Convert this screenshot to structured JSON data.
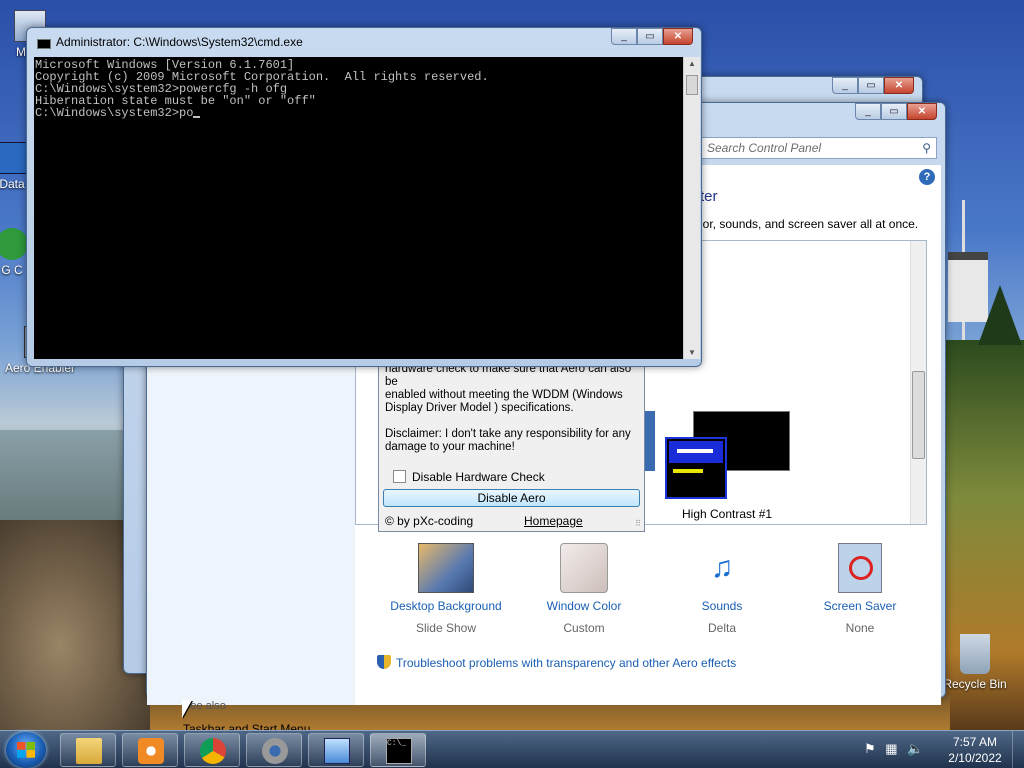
{
  "desktop": {
    "icons": [
      {
        "label": "My C"
      },
      {
        "label": "Data"
      },
      {
        "label": "G C"
      },
      {
        "label": "Aero Enabler"
      },
      {
        "label": "Recycle Bin"
      }
    ]
  },
  "cmd": {
    "title": "Administrator: C:\\Windows\\System32\\cmd.exe",
    "lines": [
      "Microsoft Windows [Version 6.1.7601]",
      "Copyright (c) 2009 Microsoft Corporation.  All rights reserved.",
      "",
      "C:\\Windows\\system32>powercfg -h ofg",
      "Hibernation state must be \"on\" or \"off\"",
      "",
      "C:\\Windows\\system32>po"
    ]
  },
  "control_panel": {
    "search_placeholder": "Search Control Panel",
    "heading_partial": "ter",
    "subtitle_partial": "lor, sounds, and screen saver all at once.",
    "high_contrast_label": "High Contrast #1",
    "tiles": [
      {
        "title": "Desktop Background",
        "sub": "Slide Show",
        "icon": "desktop-background-icon"
      },
      {
        "title": "Window Color",
        "sub": "Custom",
        "icon": "window-color-icon"
      },
      {
        "title": "Sounds",
        "sub": "Delta",
        "icon": "sounds-icon"
      },
      {
        "title": "Screen Saver",
        "sub": "None",
        "icon": "screen-saver-icon"
      }
    ],
    "see_also": "See also",
    "taskbar_link": "Taskbar and Start Menu",
    "troubleshoot_link": "Troubleshoot problems with transparency and other Aero effects"
  },
  "aero_enabler": {
    "desc_lines": [
      "hardware check to make sure that Aero can also be",
      "enabled without meeting the WDDM (Windows",
      "Display Driver Model ) specifications.",
      "",
      "Disclaimer: I don't take any responsibility for any",
      "damage to your machine!"
    ],
    "checkbox_label": "Disable Hardware Check",
    "button_label": "Disable Aero",
    "footer_left": "© by pXc-coding",
    "footer_link": "Homepage"
  },
  "taskbar": {
    "items": [
      "explorer",
      "media-player",
      "chrome",
      "settings",
      "control-panel",
      "cmd"
    ],
    "time": "7:57 AM",
    "date": "2/10/2022"
  }
}
